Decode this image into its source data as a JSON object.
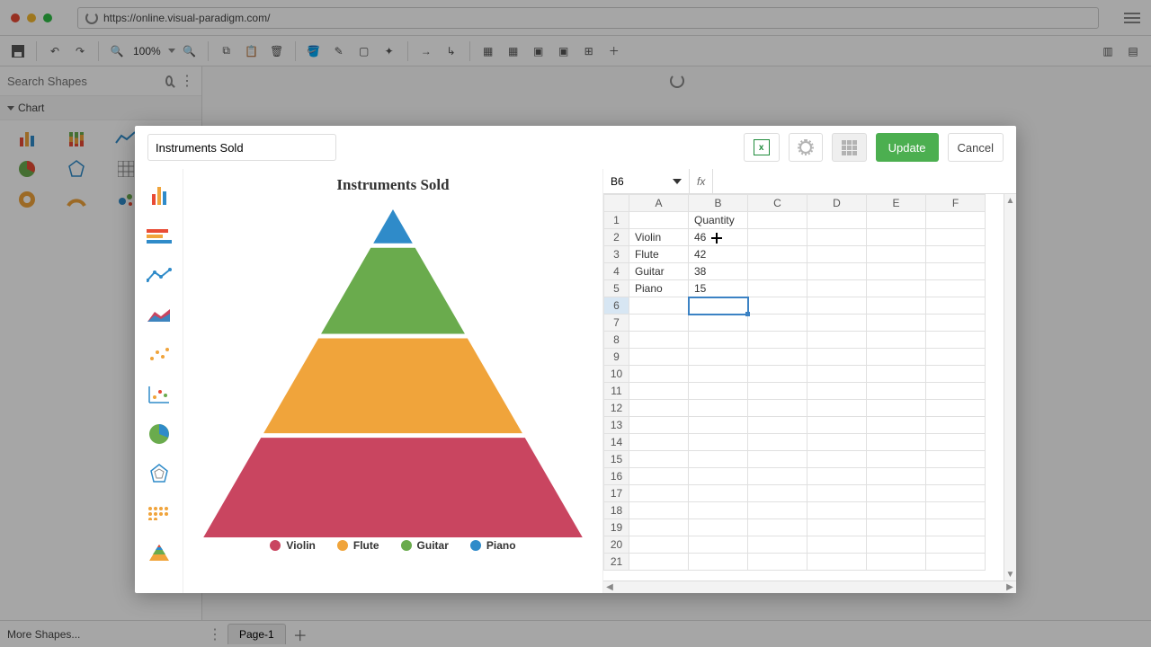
{
  "url": "https://online.visual-paradigm.com/",
  "toolbar": {
    "zoom": "100%"
  },
  "sidebar": {
    "search_placeholder": "Search Shapes",
    "section_label": "Chart",
    "more_label": "More Shapes..."
  },
  "footer": {
    "page_label": "Page-1"
  },
  "modal": {
    "title_value": "Instruments Sold",
    "update_label": "Update",
    "cancel_label": "Cancel"
  },
  "sheet": {
    "active_cell": "B6",
    "fx_label": "fx",
    "columns": [
      "A",
      "B",
      "C",
      "D",
      "E",
      "F"
    ],
    "row_count": 21,
    "header_row": {
      "B": "Quantity"
    },
    "rows": [
      {
        "A": "Violin",
        "B": 46
      },
      {
        "A": "Flute",
        "B": 42
      },
      {
        "A": "Guitar",
        "B": 38
      },
      {
        "A": "Piano",
        "B": 15
      }
    ]
  },
  "legend": [
    "Violin",
    "Flute",
    "Guitar",
    "Piano"
  ],
  "chart_data": {
    "type": "area",
    "title": "Instruments Sold",
    "categories": [
      "Violin",
      "Flute",
      "Guitar",
      "Piano"
    ],
    "values": [
      46,
      42,
      38,
      15
    ],
    "colors": [
      "#c94560",
      "#f0a43b",
      "#6aab4d",
      "#2f8bc9"
    ],
    "ylabel": "Quantity"
  }
}
